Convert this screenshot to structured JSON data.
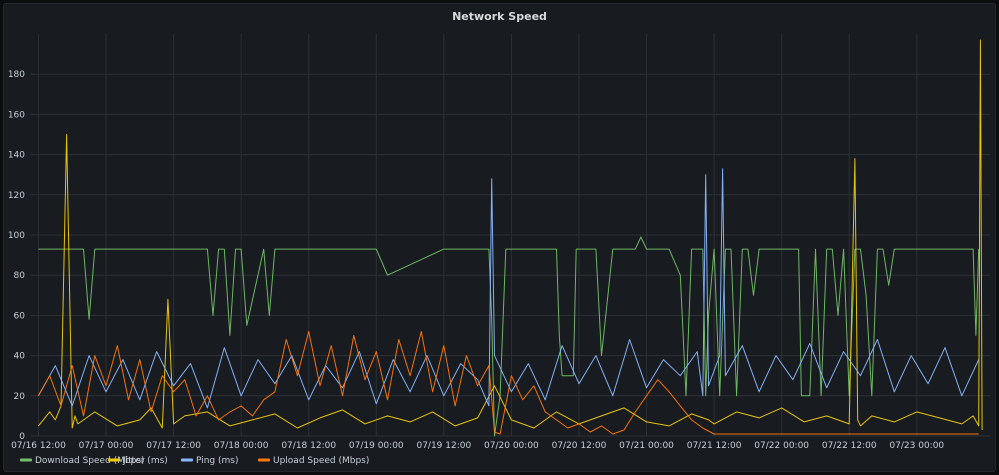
{
  "panel": {
    "title": "Network Speed"
  },
  "colors": {
    "background": "#181b1f",
    "grid": "#2c3036",
    "text": "#c7d0d9",
    "download": "#73bf69",
    "jitter": "#f2cc0c",
    "ping": "#8ab8ff",
    "upload": "#ff780a"
  },
  "chart_data": {
    "type": "line",
    "title": "Network Speed",
    "xlabel": "",
    "ylabel": "",
    "ylim": [
      0,
      200
    ],
    "y_ticks": [
      0,
      20,
      40,
      60,
      80,
      100,
      120,
      140,
      160,
      180
    ],
    "x_unit": "hours from 07/16 12:00",
    "xlim": [
      -1.5,
      169
    ],
    "x_ticks": [
      {
        "t": 0,
        "label": "07/16 12:00"
      },
      {
        "t": 12,
        "label": "07/17 00:00"
      },
      {
        "t": 24,
        "label": "07/17 12:00"
      },
      {
        "t": 36,
        "label": "07/18 00:00"
      },
      {
        "t": 48,
        "label": "07/18 12:00"
      },
      {
        "t": 60,
        "label": "07/19 00:00"
      },
      {
        "t": 72,
        "label": "07/19 12:00"
      },
      {
        "t": 84,
        "label": "07/20 00:00"
      },
      {
        "t": 96,
        "label": "07/20 12:00"
      },
      {
        "t": 108,
        "label": "07/21 00:00"
      },
      {
        "t": 120,
        "label": "07/21 12:00"
      },
      {
        "t": 132,
        "label": "07/22 00:00"
      },
      {
        "t": 144,
        "label": "07/22 12:00"
      },
      {
        "t": 156,
        "label": "07/23 00:00"
      }
    ],
    "grid": true,
    "legend_position": "bottom-left",
    "series": [
      {
        "name": "Download Speed (Mbps)",
        "color": "#73bf69",
        "x": [
          0,
          8,
          9,
          10,
          18,
          30,
          31,
          32,
          33,
          34,
          35,
          36,
          37,
          40,
          41,
          42,
          50,
          60,
          62,
          72,
          80,
          80.5,
          81,
          82,
          83,
          86,
          87,
          92,
          92.5,
          93,
          95,
          95.5,
          97,
          99,
          100,
          102,
          103,
          104,
          106,
          107,
          108,
          110,
          112,
          114,
          115,
          116,
          118,
          118.5,
          119,
          120,
          121,
          122,
          123,
          124,
          125,
          126,
          127,
          128,
          130,
          135,
          135.5,
          137,
          138,
          139,
          140,
          141,
          142,
          143,
          144,
          145,
          146,
          147,
          148,
          149,
          150,
          151,
          152,
          153,
          154,
          156,
          160,
          164,
          166,
          166.5,
          167
        ],
        "y": [
          93,
          93,
          58,
          93,
          93,
          93,
          60,
          93,
          93,
          50,
          93,
          93,
          55,
          93,
          60,
          93,
          93,
          93,
          80,
          93,
          93,
          58,
          0,
          20,
          93,
          93,
          93,
          93,
          50,
          30,
          30,
          93,
          93,
          93,
          40,
          93,
          93,
          93,
          93,
          99,
          93,
          93,
          93,
          80,
          20,
          93,
          93,
          20,
          60,
          93,
          20,
          93,
          93,
          20,
          93,
          93,
          70,
          93,
          93,
          93,
          20,
          20,
          93,
          20,
          93,
          93,
          60,
          93,
          20,
          93,
          93,
          70,
          20,
          93,
          93,
          75,
          93,
          93,
          93,
          93,
          93,
          93,
          93,
          50,
          93
        ]
      },
      {
        "name": "Jitter (ms)",
        "color": "#f2cc0c",
        "x": [
          0,
          2,
          3,
          4,
          5,
          6,
          6.5,
          7,
          10,
          14,
          18,
          20,
          22,
          23,
          24,
          26,
          30,
          34,
          38,
          42,
          46,
          50,
          54,
          58,
          62,
          66,
          70,
          74,
          78,
          81,
          84,
          88,
          92,
          96,
          100,
          104,
          108,
          112,
          116,
          119,
          120,
          124,
          128,
          132,
          136,
          140,
          144,
          145,
          145.5,
          146,
          148,
          152,
          156,
          160,
          164,
          166,
          167,
          167.3,
          167.6
        ],
        "y": [
          5,
          12,
          8,
          15,
          150,
          4,
          10,
          6,
          12,
          5,
          8,
          14,
          4,
          68,
          6,
          10,
          12,
          5,
          8,
          11,
          4,
          9,
          13,
          6,
          10,
          7,
          12,
          5,
          9,
          25,
          8,
          4,
          12,
          6,
          10,
          14,
          7,
          5,
          11,
          8,
          6,
          12,
          9,
          14,
          7,
          10,
          6,
          138,
          8,
          5,
          10,
          7,
          12,
          9,
          6,
          10,
          5,
          197,
          3
        ]
      },
      {
        "name": "Ping (ms)",
        "color": "#8ab8ff",
        "x": [
          0,
          3,
          6,
          9,
          12,
          15,
          18,
          21,
          24,
          27,
          30,
          33,
          36,
          39,
          42,
          45,
          48,
          51,
          54,
          57,
          60,
          63,
          66,
          69,
          72,
          75,
          78,
          80,
          80.5,
          81,
          84,
          87,
          90,
          93,
          96,
          99,
          102,
          105,
          108,
          111,
          114,
          117,
          118,
          118.5,
          119,
          121,
          121.5,
          122,
          125,
          128,
          131,
          134,
          137,
          140,
          143,
          146,
          149,
          152,
          155,
          158,
          161,
          164,
          167
        ],
        "y": [
          20,
          35,
          15,
          40,
          22,
          38,
          18,
          42,
          25,
          36,
          14,
          44,
          20,
          38,
          26,
          40,
          18,
          35,
          24,
          42,
          16,
          38,
          22,
          40,
          20,
          36,
          28,
          15,
          128,
          40,
          22,
          36,
          18,
          45,
          26,
          40,
          20,
          48,
          24,
          38,
          30,
          42,
          20,
          130,
          25,
          40,
          133,
          30,
          45,
          22,
          40,
          28,
          46,
          24,
          42,
          30,
          48,
          22,
          40,
          26,
          44,
          20,
          38
        ]
      },
      {
        "name": "Upload Speed (Mbps)",
        "color": "#ff780a",
        "x": [
          0,
          2,
          4,
          6,
          8,
          10,
          12,
          14,
          16,
          18,
          20,
          22,
          24,
          26,
          28,
          30,
          32,
          34,
          36,
          38,
          40,
          42,
          44,
          46,
          48,
          50,
          52,
          54,
          56,
          58,
          60,
          62,
          64,
          66,
          68,
          70,
          72,
          74,
          76,
          78,
          80,
          81,
          82,
          84,
          86,
          88,
          90,
          92,
          94,
          96,
          98,
          100,
          102,
          104,
          106,
          108,
          110,
          112,
          114,
          116,
          118,
          120,
          124,
          128,
          132,
          136,
          140,
          144,
          148,
          152,
          156,
          160,
          164,
          167
        ],
        "y": [
          20,
          30,
          15,
          35,
          10,
          40,
          25,
          45,
          18,
          38,
          12,
          30,
          22,
          28,
          10,
          20,
          8,
          12,
          15,
          10,
          18,
          22,
          48,
          30,
          52,
          25,
          45,
          20,
          50,
          28,
          42,
          18,
          48,
          30,
          52,
          22,
          45,
          15,
          40,
          25,
          35,
          2,
          1,
          30,
          18,
          25,
          12,
          8,
          4,
          6,
          2,
          5,
          1,
          3,
          12,
          20,
          28,
          22,
          15,
          8,
          4,
          1,
          1,
          1,
          1,
          1,
          1,
          1,
          1,
          1,
          1,
          1,
          1,
          1
        ]
      }
    ]
  }
}
